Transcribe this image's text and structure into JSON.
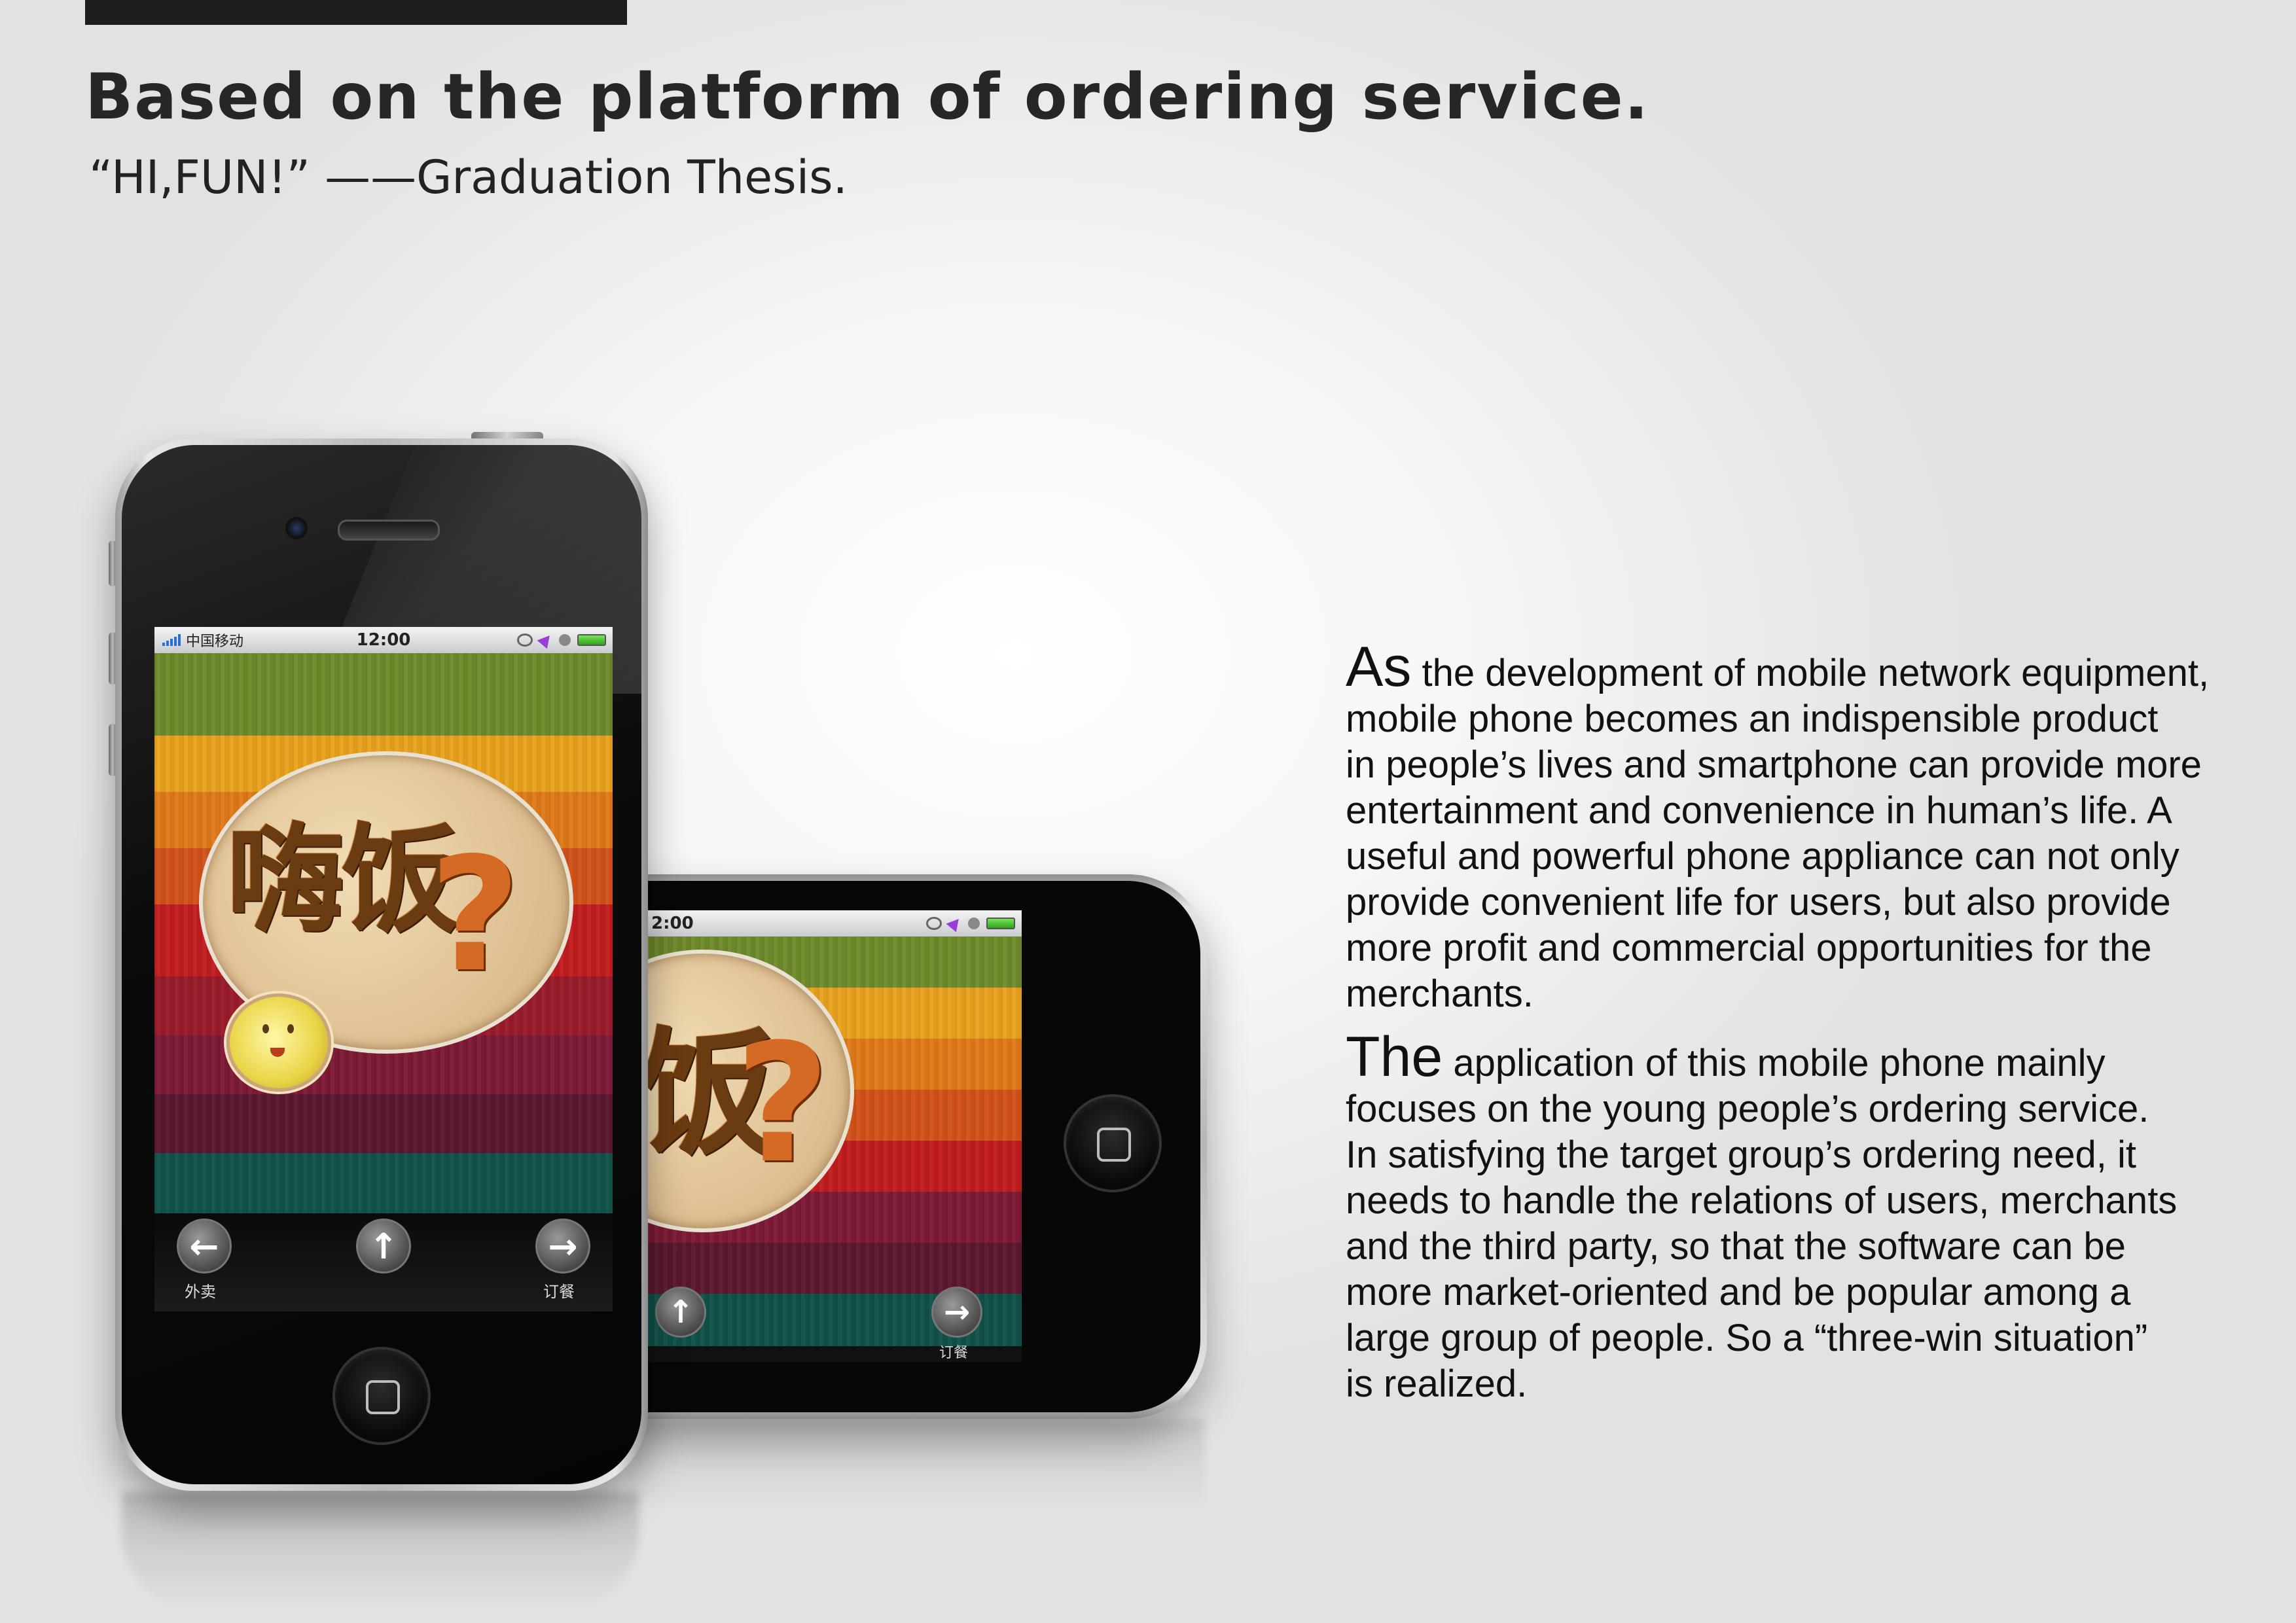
{
  "header": {
    "title": "Based on the platform of ordering service.",
    "subtitle": "“HI,FUN!” ——Graduation Thesis."
  },
  "phone_screen": {
    "carrier": "中国移动",
    "time": "12:00",
    "time_landscape": "2:00",
    "logo_text": "嗨饭",
    "logo_text_landscape": "饭",
    "logo_mark": "?",
    "nav": {
      "left_label": "外卖",
      "right_label": "订餐",
      "right_label_landscape": "订餐"
    },
    "icons": [
      "signal-icon",
      "rotation-lock-icon",
      "location-icon",
      "alarm-icon",
      "battery-icon",
      "arrow-left-icon",
      "arrow-up-icon",
      "arrow-right-icon",
      "home-button-icon"
    ]
  },
  "paragraphs": [
    {
      "lead": "As",
      "lines": [
        " the development of mobile network equipment,",
        "mobile phone becomes an indispensible product",
        "in people’s lives and smartphone can provide more",
        "entertainment and convenience in human’s life. A",
        "useful and powerful phone appliance can not only",
        "provide convenient life for users, but also provide",
        "more profit and commercial opportunities for the",
        "merchants."
      ]
    },
    {
      "lead": "The",
      "lines": [
        " application of this mobile phone mainly",
        "focuses on the young people’s ordering service.",
        "In satisfying the target group’s ordering need, it",
        "needs to handle the relations of users, merchants",
        "and the third party, so that the software can be",
        "more market-oriented and be popular among a",
        "large group of people. So a “three-win situation”",
        "is realized."
      ]
    }
  ],
  "colors": {
    "stripes": [
      "#6f8a2c",
      "#e9a21e",
      "#df7a1a",
      "#d2521a",
      "#c21d1f",
      "#7e1a35",
      "#2a1428",
      "#10524a"
    ]
  }
}
